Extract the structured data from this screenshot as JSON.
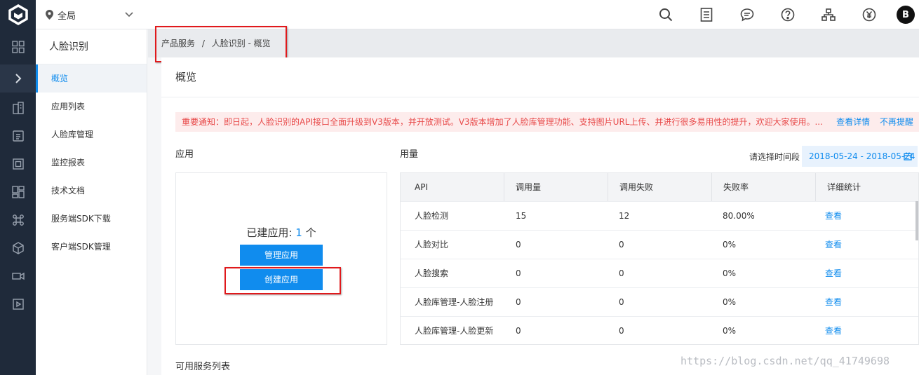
{
  "topbar": {
    "region": "全局",
    "avatar_letter": "B"
  },
  "subnav": {
    "title": "人脸识别",
    "items": [
      "概览",
      "应用列表",
      "人脸库管理",
      "监控报表",
      "技术文档",
      "服务端SDK下载",
      "客户端SDK管理"
    ]
  },
  "breadcrumb": {
    "root": "产品服务",
    "sep": "/",
    "current": "人脸识别 - 概览"
  },
  "page": {
    "title": "概览",
    "notice": "重要通知：即日起，人脸识别的API接口全面升级到V3版本，并开放测试。V3版本增加了人脸库管理功能、支持图片URL上传、并进行很多易用性的提升，欢迎大家使用。...",
    "notice_link_detail": "查看详情",
    "notice_link_dismiss": "不再提醒",
    "app_section": "应用",
    "usage_section": "用量",
    "date_label": "请选择时间段",
    "date_range": "2018-05-24 - 2018-05-24",
    "app_count_prefix": "已建应用: ",
    "app_count": "1",
    "app_count_suffix": " 个",
    "manage_button": "管理应用",
    "create_button": "创建应用",
    "services_section": "可用服务列表"
  },
  "table": {
    "headers": [
      "API",
      "调用量",
      "调用失败",
      "失败率",
      "详细统计"
    ],
    "rows": [
      [
        "人脸检测",
        "15",
        "12",
        "80.00%",
        "查看"
      ],
      [
        "人脸对比",
        "0",
        "0",
        "0%",
        "查看"
      ],
      [
        "人脸搜索",
        "0",
        "0",
        "0%",
        "查看"
      ],
      [
        "人脸库管理-人脸注册",
        "0",
        "0",
        "0%",
        "查看"
      ],
      [
        "人脸库管理-人脸更新",
        "0",
        "0",
        "0%",
        "查看"
      ]
    ]
  },
  "watermark": "https://blog.csdn.net/qq_41749698",
  "colors": {
    "accent": "#108cee",
    "rail": "#1f2a3a",
    "annotation": "#e0191c",
    "notice_text": "#e84a4a"
  }
}
